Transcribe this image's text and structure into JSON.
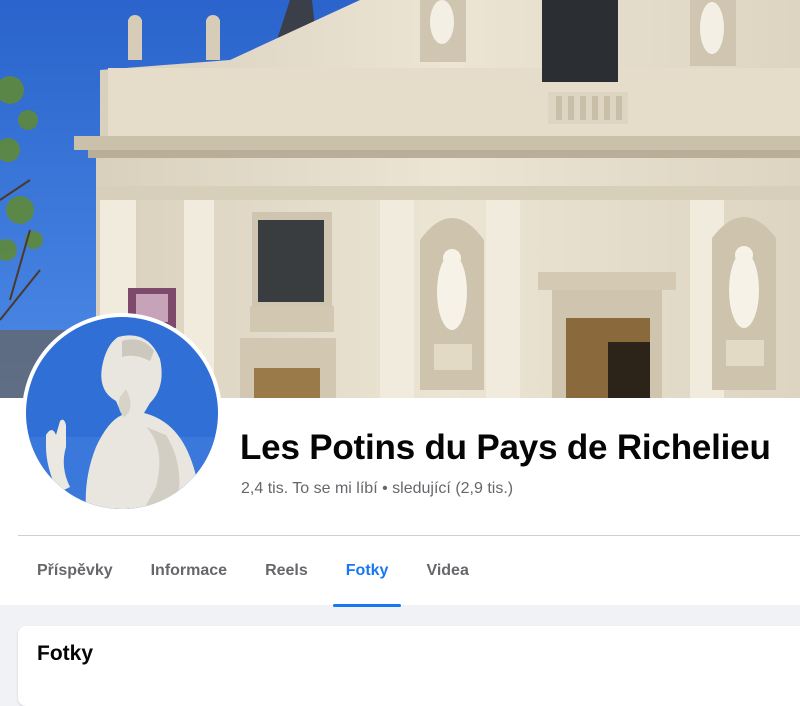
{
  "page": {
    "name": "Les Potins du Pays de Richelieu",
    "likes": "2,4 tis. To se mi líbí",
    "separator": "•",
    "followers": "sledující (2,9 tis.)"
  },
  "tabs": [
    {
      "label": "Příspěvky",
      "active": false
    },
    {
      "label": "Informace",
      "active": false
    },
    {
      "label": "Reels",
      "active": false
    },
    {
      "label": "Fotky",
      "active": true
    },
    {
      "label": "Videa",
      "active": false
    }
  ],
  "section": {
    "title": "Fotky"
  },
  "colors": {
    "accent": "#1877f2",
    "text_primary": "#050505",
    "text_secondary": "#65676b",
    "background": "#f0f2f5",
    "sky": "#2f6fd6",
    "stone": "#e9e1d0"
  },
  "icons": {
    "cover": "church-facade-photo",
    "avatar": "statue-profile-photo"
  }
}
